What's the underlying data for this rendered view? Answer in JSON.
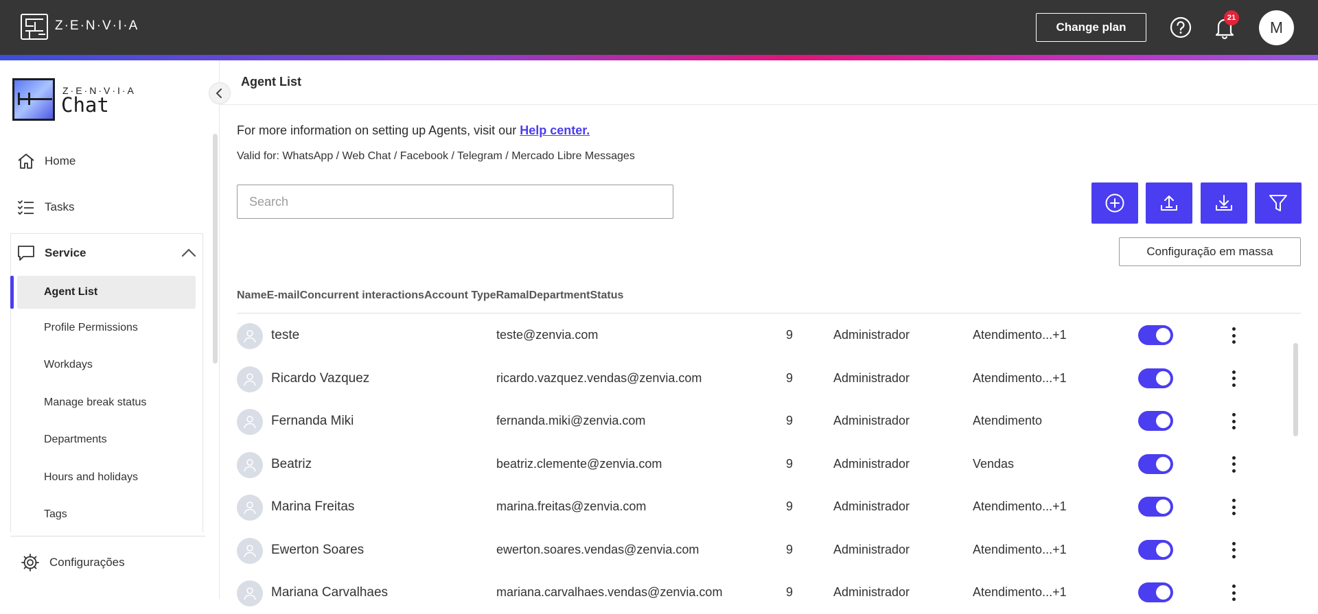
{
  "topbar": {
    "brand": "Z·E·N·V·I·A",
    "change_plan_label": "Change plan",
    "notification_count": "21",
    "avatar_initial": "M"
  },
  "sidebar": {
    "app_logo_sup": "Z·E·N·V·I·A",
    "app_logo_name": "Chat",
    "items": [
      {
        "label": "Home",
        "icon": "home-icon"
      },
      {
        "label": "Tasks",
        "icon": "tasks-icon"
      }
    ],
    "service": {
      "label": "Service",
      "icon": "chat-bubble-icon",
      "subitems": [
        {
          "label": "Agent List",
          "active": true
        },
        {
          "label": "Profile Permissions"
        },
        {
          "label": "Workdays"
        },
        {
          "label": "Manage break status"
        },
        {
          "label": "Departments"
        },
        {
          "label": "Hours and holidays"
        },
        {
          "label": "Tags"
        }
      ]
    },
    "settings_label": "Configurações"
  },
  "main": {
    "title": "Agent List",
    "info_text": "For more information on setting up Agents, visit our ",
    "help_link": "Help center.",
    "valid_for": "Valid for: WhatsApp / Web Chat / Facebook / Telegram / Mercado Libre Messages",
    "search_placeholder": "Search",
    "mass_config_label": "Configuração em massa",
    "columns": [
      "Name",
      "E-mail",
      "Concurrent interactions",
      "Account Type",
      "Ramal",
      "Department",
      "Status"
    ],
    "rows": [
      {
        "name": "teste",
        "email": "teste@zenvia.com",
        "concurrent": "9",
        "type": "Administrador",
        "department": "Atendimento...+1",
        "status": true
      },
      {
        "name": "Ricardo Vazquez",
        "email": "ricardo.vazquez.vendas@zenvia.com",
        "concurrent": "9",
        "type": "Administrador",
        "department": "Atendimento...+1",
        "status": true
      },
      {
        "name": "Fernanda Miki",
        "email": "fernanda.miki@zenvia.com",
        "concurrent": "9",
        "type": "Administrador",
        "department": "Atendimento",
        "status": true
      },
      {
        "name": "Beatriz",
        "email": "beatriz.clemente@zenvia.com",
        "concurrent": "9",
        "type": "Administrador",
        "department": "Vendas",
        "status": true
      },
      {
        "name": "Marina Freitas",
        "email": "marina.freitas@zenvia.com",
        "concurrent": "9",
        "type": "Administrador",
        "department": "Atendimento...+1",
        "status": true
      },
      {
        "name": "Ewerton Soares",
        "email": "ewerton.soares.vendas@zenvia.com",
        "concurrent": "9",
        "type": "Administrador",
        "department": "Atendimento...+1",
        "status": true
      },
      {
        "name": "Mariana Carvalhaes",
        "email": "mariana.carvalhaes.vendas@zenvia.com",
        "concurrent": "9",
        "type": "Administrador",
        "department": "Atendimento...+1",
        "status": true
      }
    ]
  },
  "colors": {
    "accent": "#4b3df0",
    "topbar": "#363636",
    "badge": "#e0243a"
  }
}
